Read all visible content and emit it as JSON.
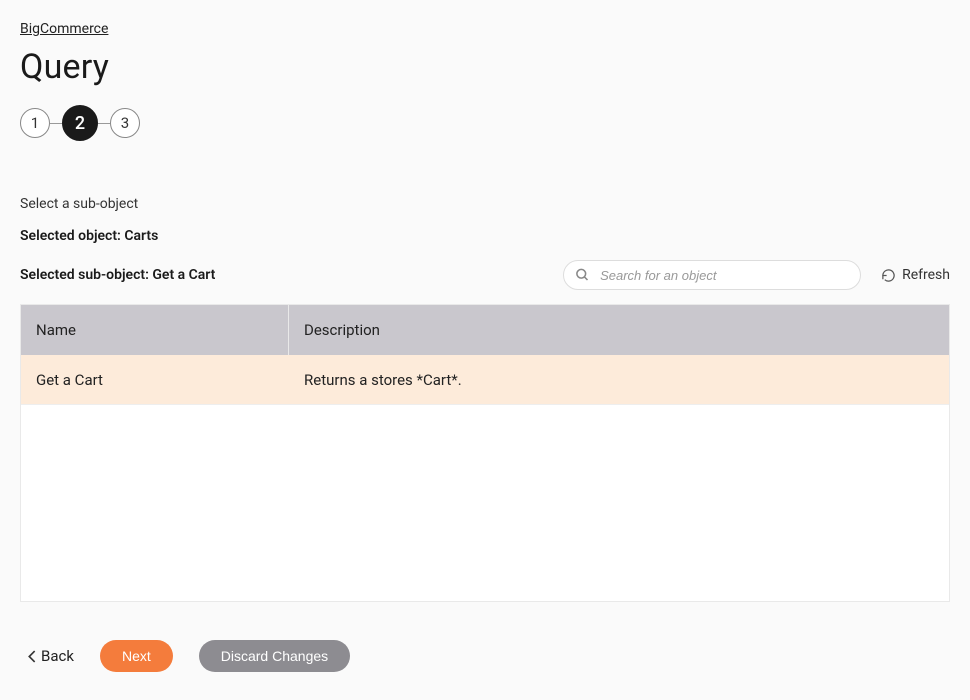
{
  "breadcrumb": "BigCommerce",
  "title": "Query",
  "stepper": {
    "steps": [
      "1",
      "2",
      "3"
    ],
    "active": 1
  },
  "instruction": "Select a sub-object",
  "selectedObjectLabel": "Selected object: Carts",
  "selectedSubObjectLabel": "Selected sub-object: Get a Cart",
  "search": {
    "placeholder": "Search for an object"
  },
  "refreshLabel": "Refresh",
  "table": {
    "headers": {
      "name": "Name",
      "description": "Description"
    },
    "rows": [
      {
        "name": "Get a Cart",
        "description": "Returns a stores *Cart*."
      }
    ]
  },
  "footer": {
    "back": "Back",
    "next": "Next",
    "discard": "Discard Changes"
  }
}
